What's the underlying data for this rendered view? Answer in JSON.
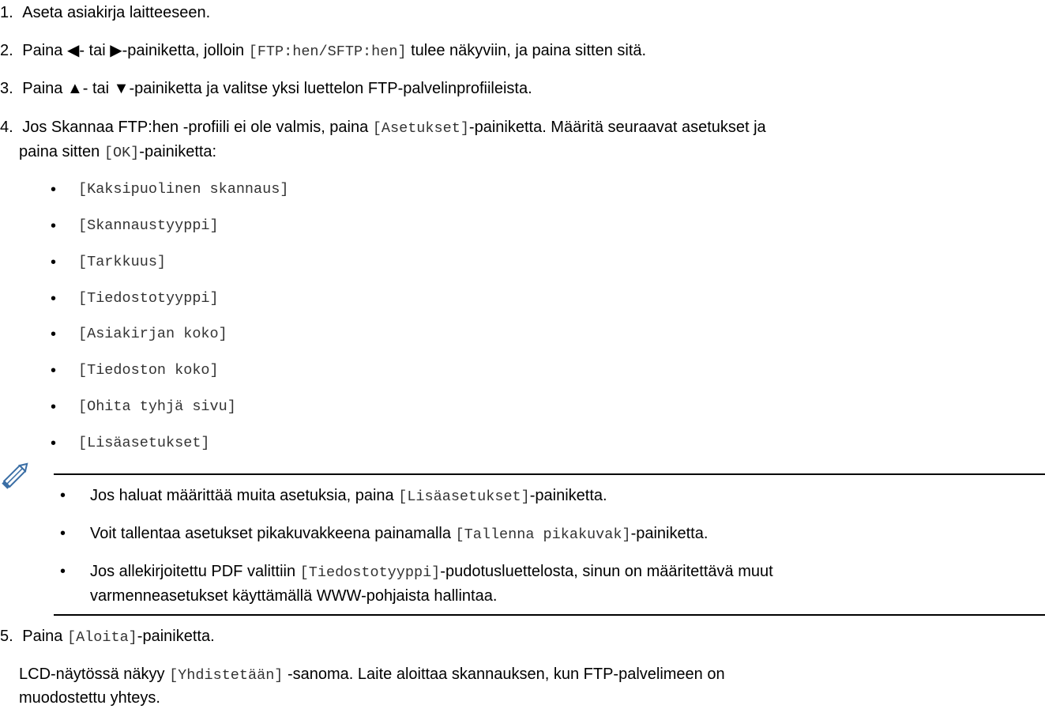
{
  "steps": [
    {
      "num": "1.",
      "text": "Aseta asiakirja laitteeseen."
    },
    {
      "num": "2.",
      "pre": "Paina ◀- tai ▶-painiketta, jolloin ",
      "code": "[FTP:hen/SFTP:hen]",
      "post": " tulee näkyviin, ja paina sitten sitä."
    },
    {
      "num": "3.",
      "text": "Paina ▲- tai ▼-painiketta ja valitse yksi luettelon FTP-palvelinprofiileista."
    },
    {
      "num": "4.",
      "pre": "Jos Skannaa FTP:hen -profiili ei ole valmis, paina ",
      "code": "[Asetukset]",
      "post": "-painiketta. Määritä seuraavat asetukset ja",
      "line2_pre": "paina sitten ",
      "line2_code": "[OK]",
      "line2_post": "-painiketta:"
    },
    {
      "num": "5.",
      "pre": "Paina ",
      "code": "[Aloita]",
      "post": "-painiketta."
    }
  ],
  "settings": [
    "[Kaksipuolinen skannaus]",
    "[Skannaustyyppi]",
    "[Tarkkuus]",
    "[Tiedostotyyppi]",
    "[Asiakirjan koko]",
    "[Tiedoston koko]",
    "[Ohita tyhjä sivu]",
    "[Lisäasetukset]"
  ],
  "notes": [
    {
      "pre": "Jos haluat määrittää muita asetuksia, paina ",
      "code": "[Lisäasetukset]",
      "post": "-painiketta."
    },
    {
      "pre": "Voit tallentaa asetukset pikakuvakkeena painamalla ",
      "code": "[Tallenna pikakuvak]",
      "post": "-painiketta."
    },
    {
      "pre": "Jos allekirjoitettu PDF valittiin ",
      "code": "[Tiedostotyyppi]",
      "post": "-pudotusluettelosta, sinun on määritettävä muut",
      "line2": "varmenneasetukset käyttämällä WWW-pohjaista hallintaa."
    }
  ],
  "final": {
    "pre": "LCD-näytössä näkyy ",
    "code": "[Yhdistetään]",
    "post": " -sanoma. Laite aloittaa skannauksen, kun FTP-palvelimeen on",
    "line2": "muodostettu yhteys."
  }
}
